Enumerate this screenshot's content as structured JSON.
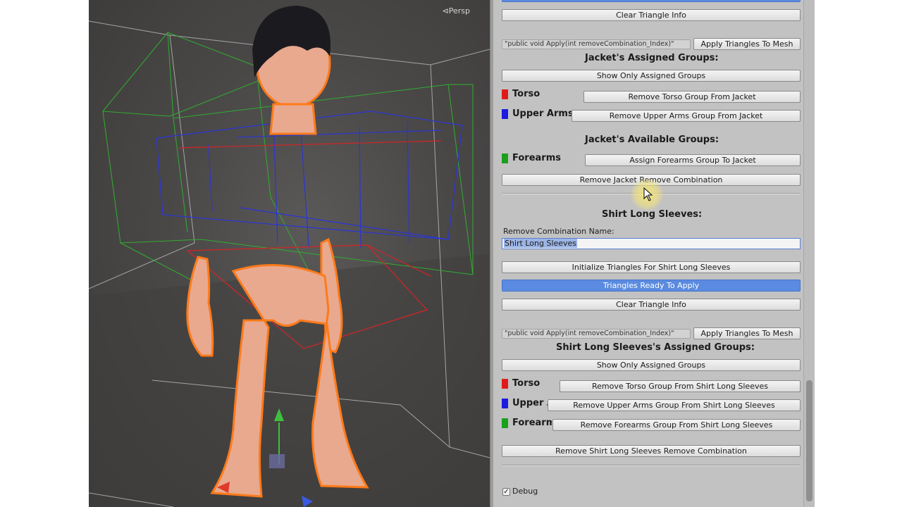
{
  "viewport": {
    "projection_label": "Persp"
  },
  "jacket": {
    "clear_triangle_info": "Clear Triangle Info",
    "apply_signature": "\"public void Apply(int removeCombination_Index)\"",
    "apply_button": "Apply Triangles To Mesh",
    "assigned_header": "Jacket's Assigned Groups:",
    "show_only_assigned": "Show Only Assigned Groups",
    "assigned_groups": [
      {
        "label": "Torso",
        "color": "#e01a1a",
        "button": "Remove Torso Group From Jacket"
      },
      {
        "label": "Upper Arms",
        "color": "#1a1ae0",
        "button": "Remove Upper Arms Group From Jacket"
      }
    ],
    "available_header": "Jacket's Available Groups:",
    "available_groups": [
      {
        "label": "Forearms",
        "color": "#1aa01a",
        "button": "Assign Forearms Group To Jacket"
      }
    ],
    "remove_combination": "Remove Jacket Remove Combination"
  },
  "shirt": {
    "header": "Shirt Long Sleeves:",
    "name_label": "Remove Combination Name:",
    "name_value": "Shirt Long Sleeves",
    "initialize_button": "Initialize Triangles For Shirt Long Sleeves",
    "status": "Triangles Ready To Apply",
    "clear_triangle_info": "Clear Triangle Info",
    "apply_signature": "\"public void Apply(int removeCombination_Index)\"",
    "apply_button": "Apply Triangles To Mesh",
    "assigned_header": "Shirt Long Sleeves's Assigned Groups:",
    "show_only_assigned": "Show Only Assigned Groups",
    "assigned_groups": [
      {
        "label": "Torso",
        "color": "#e01a1a",
        "button": "Remove Torso Group From Shirt Long Sleeves"
      },
      {
        "label": "Upper Arms",
        "color": "#1a1ae0",
        "button": "Remove Upper Arms Group From Shirt Long Sleeves"
      },
      {
        "label": "Forearms",
        "color": "#1aa01a",
        "button": "Remove Forearms Group From Shirt Long Sleeves"
      }
    ],
    "remove_combination": "Remove Shirt Long Sleeves Remove Combination"
  },
  "footer": {
    "debug_label": "Debug",
    "debug_checked": true
  },
  "colors": {
    "panel": "#c2c2c2",
    "status_blue": "#5b8be0",
    "selection_outline": "#ff7a1a"
  }
}
